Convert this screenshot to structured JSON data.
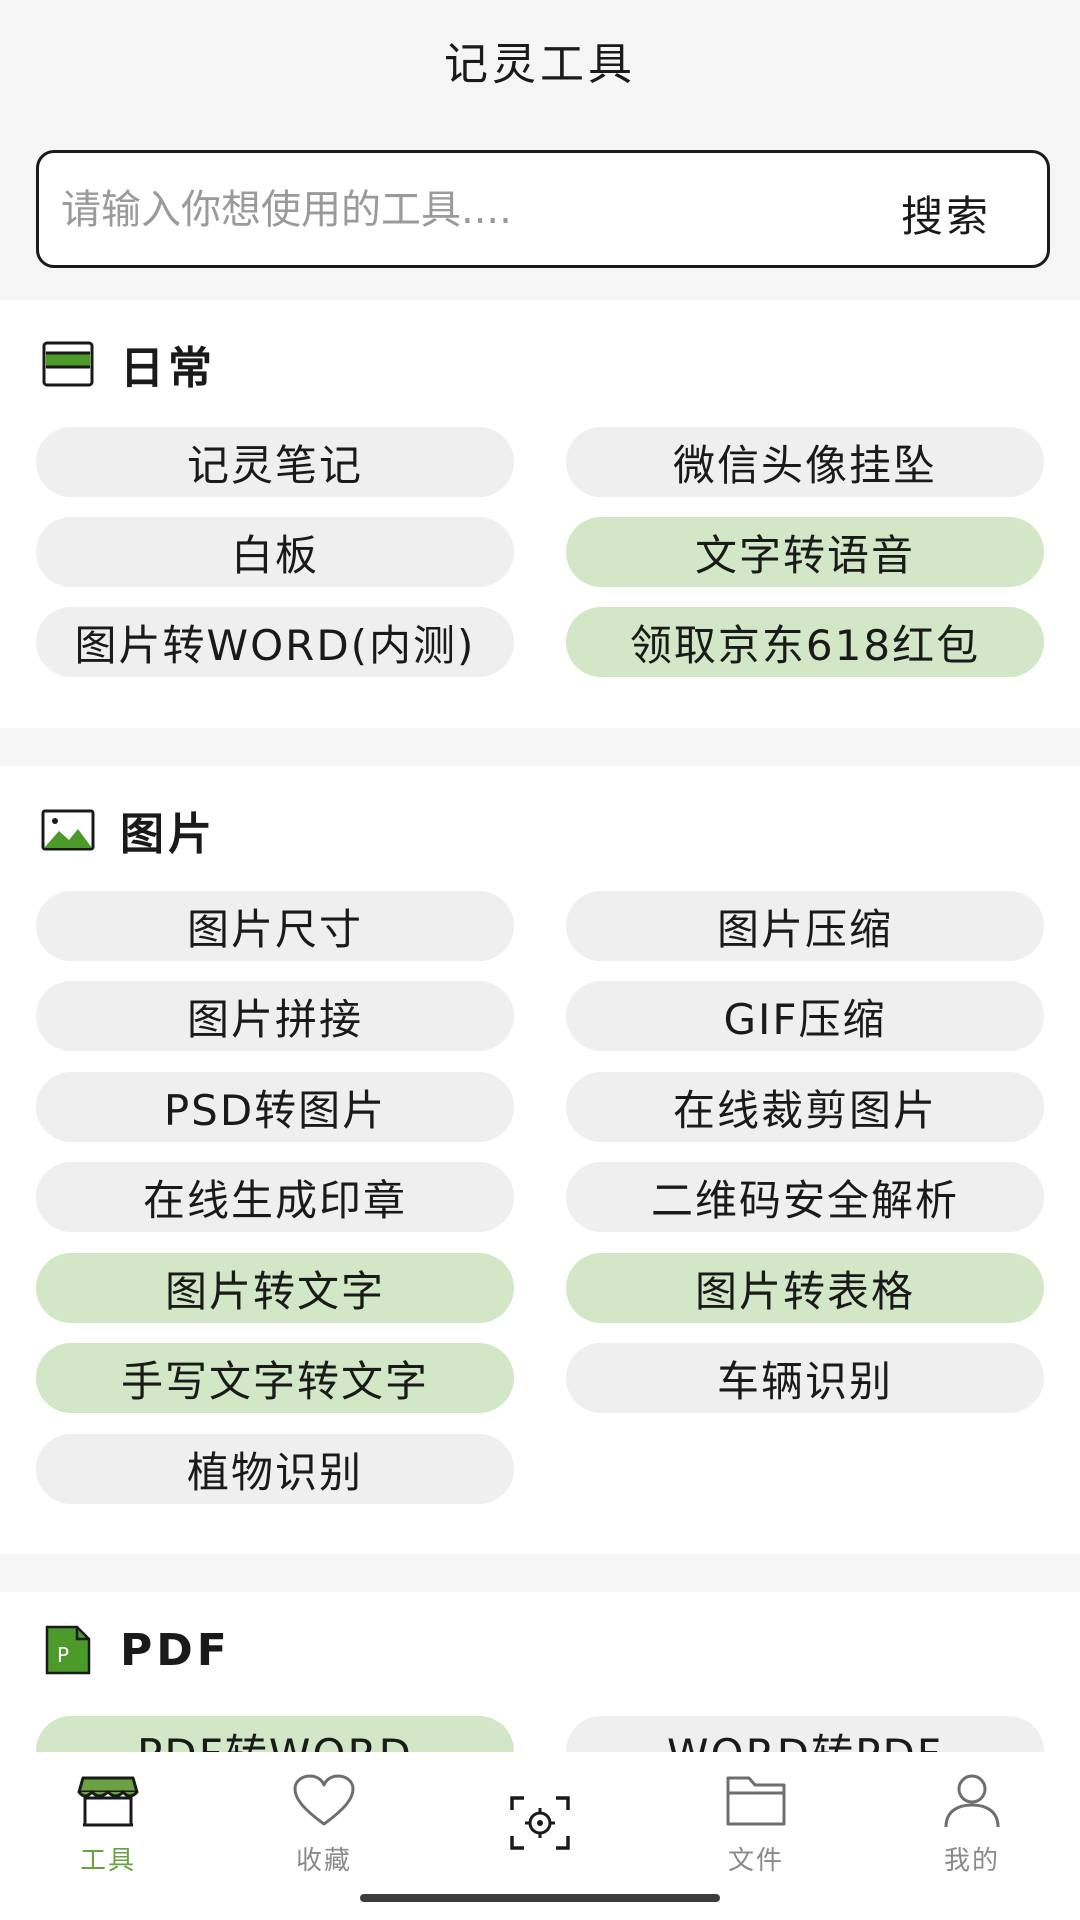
{
  "app": {
    "title": "记灵工具"
  },
  "search": {
    "placeholder": "请输入你想使用的工具....",
    "value": "",
    "button_label": "搜索"
  },
  "sections": {
    "daily": {
      "title": "日常",
      "icon": "card-icon",
      "tools": [
        {
          "label": "记灵笔记",
          "highlighted": false
        },
        {
          "label": "微信头像挂坠",
          "highlighted": false
        },
        {
          "label": "白板",
          "highlighted": false
        },
        {
          "label": "文字转语音",
          "highlighted": true
        },
        {
          "label": "图片转WORD(内测)",
          "highlighted": false
        },
        {
          "label": "领取京东618红包",
          "highlighted": true
        }
      ]
    },
    "image": {
      "title": "图片",
      "icon": "image-icon",
      "tools": [
        {
          "label": "图片尺寸",
          "highlighted": false
        },
        {
          "label": "图片压缩",
          "highlighted": false
        },
        {
          "label": "图片拼接",
          "highlighted": false
        },
        {
          "label": "GIF压缩",
          "highlighted": false
        },
        {
          "label": "PSD转图片",
          "highlighted": false
        },
        {
          "label": "在线裁剪图片",
          "highlighted": false
        },
        {
          "label": "在线生成印章",
          "highlighted": false
        },
        {
          "label": "二维码安全解析",
          "highlighted": false
        },
        {
          "label": "图片转文字",
          "highlighted": true
        },
        {
          "label": "图片转表格",
          "highlighted": true
        },
        {
          "label": "手写文字转文字",
          "highlighted": true
        },
        {
          "label": "车辆识别",
          "highlighted": false
        },
        {
          "label": "植物识别",
          "highlighted": false
        }
      ]
    },
    "pdf": {
      "title": "PDF",
      "icon": "pdf-file-icon",
      "tools": [
        {
          "label": "PDF转WORD",
          "highlighted": true
        },
        {
          "label": "WORD转PDF",
          "highlighted": false
        }
      ]
    }
  },
  "bottom_nav": [
    {
      "label": "工具",
      "icon": "store-icon",
      "active": true
    },
    {
      "label": "收藏",
      "icon": "heart-icon",
      "active": false
    },
    {
      "label": "",
      "icon": "scan-icon",
      "active": false
    },
    {
      "label": "文件",
      "icon": "folder-icon",
      "active": false
    },
    {
      "label": "我的",
      "icon": "user-icon",
      "active": false
    }
  ],
  "colors": {
    "accent": "#6aa142",
    "highlight_pill": "#d2e7c6",
    "pill": "#efefef",
    "background": "#f5f5f5"
  }
}
